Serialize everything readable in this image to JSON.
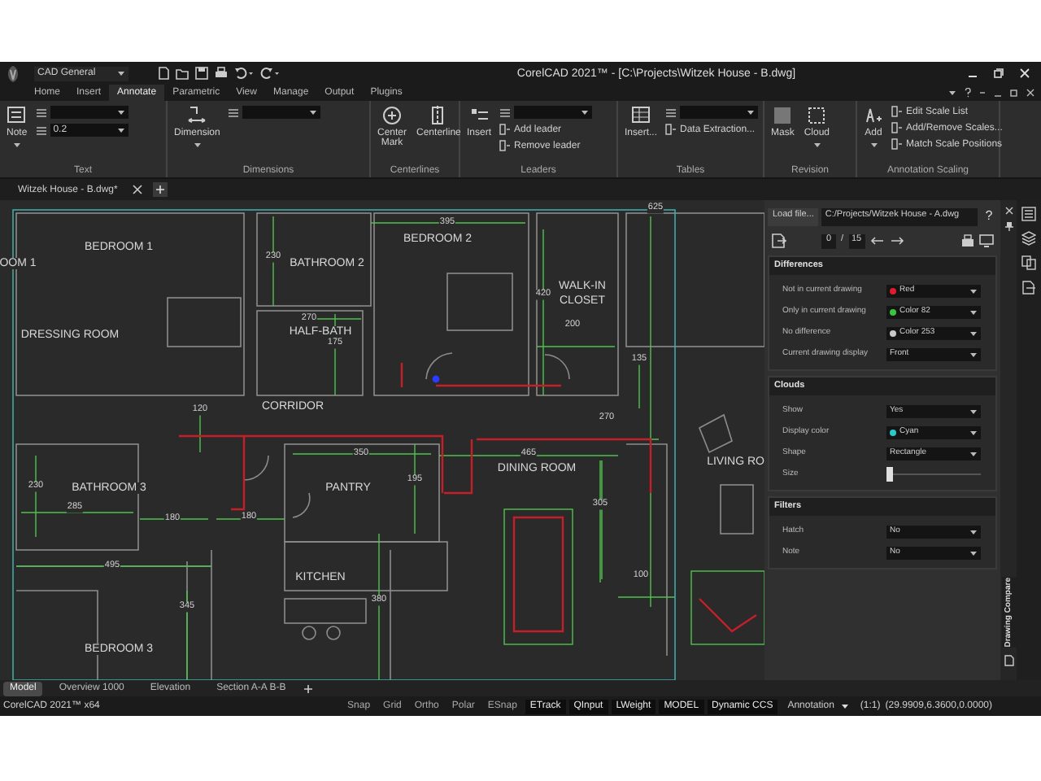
{
  "title_bar": {
    "workspace": "CAD General",
    "title": "CorelCAD 2021™ - [C:\\Projects\\Witzek House - B.dwg]"
  },
  "ribbon_tabs": [
    {
      "label": "Home",
      "selected": false
    },
    {
      "label": "Insert",
      "selected": false
    },
    {
      "label": "Annotate",
      "selected": true
    },
    {
      "label": "Parametric",
      "selected": false
    },
    {
      "label": "View",
      "selected": false
    },
    {
      "label": "Manage",
      "selected": false
    },
    {
      "label": "Output",
      "selected": false
    },
    {
      "label": "Plugins",
      "selected": false
    }
  ],
  "ribbon_groups": [
    {
      "label": "Text",
      "items": [
        {
          "kind": "large",
          "label": "Note",
          "menu": true
        },
        {
          "kind": "stack",
          "items": [
            {
              "kind": "field"
            },
            {
              "kind": "field",
              "value": "0.2"
            }
          ]
        }
      ]
    },
    {
      "label": "Dimensions",
      "items": [
        {
          "kind": "large",
          "label": "Dimension",
          "menu": true
        },
        {
          "kind": "stack",
          "items": [
            {
              "kind": "field"
            }
          ]
        }
      ]
    },
    {
      "label": "Centerlines",
      "items": [
        {
          "kind": "large",
          "label": "Center Mark",
          "menu": false
        },
        {
          "kind": "large",
          "label": "Centerline",
          "menu": false
        }
      ]
    },
    {
      "label": "Leaders",
      "items": [
        {
          "kind": "large",
          "label": "Insert",
          "menu": false
        },
        {
          "kind": "stack",
          "items": [
            {
              "kind": "field"
            },
            {
              "kind": "small",
              "label": "Add leader"
            },
            {
              "kind": "small",
              "label": "Remove leader"
            }
          ]
        }
      ]
    },
    {
      "label": "Tables",
      "items": [
        {
          "kind": "large",
          "label": "Insert...",
          "menu": false
        },
        {
          "kind": "stack",
          "items": [
            {
              "kind": "field"
            },
            {
              "kind": "small",
              "label": "Data Extraction..."
            }
          ]
        }
      ]
    },
    {
      "label": "Revision",
      "items": [
        {
          "kind": "large",
          "label": "Mask",
          "menu": false
        },
        {
          "kind": "large",
          "label": "Cloud",
          "menu": true
        }
      ]
    },
    {
      "label": "Annotation Scaling",
      "items": [
        {
          "kind": "large",
          "label": "Add",
          "menu": true
        },
        {
          "kind": "stack",
          "items": [
            {
              "kind": "small",
              "label": "Edit Scale List"
            },
            {
              "kind": "small",
              "label": "Add/Remove Scales..."
            },
            {
              "kind": "small",
              "label": "Match Scale Positions"
            }
          ]
        }
      ]
    }
  ],
  "document_tab": {
    "label": "Witzek House - B.dwg*"
  },
  "drawing": {
    "labels": [
      {
        "text": "OOM 1",
        "kind": "room"
      },
      {
        "text": "BEDROOM 1",
        "kind": "room"
      },
      {
        "text": "DRESSING ROOM",
        "kind": "room"
      },
      {
        "text": "230",
        "kind": "dimension"
      },
      {
        "text": "BATHROOM 2",
        "kind": "room"
      },
      {
        "text": "395",
        "kind": "dimension"
      },
      {
        "text": "BEDROOM 2",
        "kind": "room"
      },
      {
        "text": "625",
        "kind": "dimension"
      },
      {
        "text": "420",
        "kind": "dimension"
      },
      {
        "text": "WALK-IN",
        "kind": "room"
      },
      {
        "text": "CLOSET",
        "kind": "room"
      },
      {
        "text": "270",
        "kind": "dimension"
      },
      {
        "text": "HALF-BATH",
        "kind": "room"
      },
      {
        "text": "175",
        "kind": "dimension"
      },
      {
        "text": "200",
        "kind": "dimension"
      },
      {
        "text": "135",
        "kind": "dimension"
      },
      {
        "text": "120",
        "kind": "dimension"
      },
      {
        "text": "CORRIDOR",
        "kind": "room"
      },
      {
        "text": "270",
        "kind": "dimension"
      },
      {
        "text": "350",
        "kind": "dimension"
      },
      {
        "text": "465",
        "kind": "dimension"
      },
      {
        "text": "DINING ROOM",
        "kind": "room"
      },
      {
        "text": "LIVING RO",
        "kind": "room"
      },
      {
        "text": "195",
        "kind": "dimension"
      },
      {
        "text": "230",
        "kind": "dimension"
      },
      {
        "text": "BATHROOM 3",
        "kind": "room"
      },
      {
        "text": "PANTRY",
        "kind": "room"
      },
      {
        "text": "285",
        "kind": "dimension"
      },
      {
        "text": "180",
        "kind": "dimension"
      },
      {
        "text": "180",
        "kind": "dimension"
      },
      {
        "text": "305",
        "kind": "dimension"
      },
      {
        "text": "495",
        "kind": "dimension"
      },
      {
        "text": "KITCHEN",
        "kind": "room"
      },
      {
        "text": "345",
        "kind": "dimension"
      },
      {
        "text": "380",
        "kind": "dimension"
      },
      {
        "text": "100",
        "kind": "dimension"
      },
      {
        "text": "BEDROOM 3",
        "kind": "room"
      }
    ]
  },
  "compare_panel": {
    "load_button": "Load file...",
    "file_path": "C:/Projects/Witzek House - A.dwg",
    "help": "?",
    "current": "0",
    "separator": "/",
    "total": "15",
    "sections": [
      {
        "title": "Differences",
        "rows": [
          {
            "kind": "dropdown",
            "label": "Not in current drawing",
            "value": "Red",
            "color": "#e01b2c"
          },
          {
            "kind": "dropdown",
            "label": "Only in current drawing",
            "value": "Color 82",
            "color": "#3cc43c"
          },
          {
            "kind": "dropdown",
            "label": "No difference",
            "value": "Color 253",
            "color": "#c8c8c8"
          },
          {
            "kind": "dropdown",
            "label": "Current drawing display",
            "value": "Front"
          }
        ]
      },
      {
        "title": "Clouds",
        "rows": [
          {
            "kind": "dropdown",
            "label": "Show",
            "value": "Yes"
          },
          {
            "kind": "dropdown",
            "label": "Display color",
            "value": "Cyan",
            "color": "#2ec8c8"
          },
          {
            "kind": "dropdown",
            "label": "Shape",
            "value": "Rectangle"
          },
          {
            "kind": "slider",
            "label": "Size",
            "level": 0
          }
        ]
      },
      {
        "title": "Filters",
        "rows": [
          {
            "kind": "dropdown",
            "label": "Hatch",
            "value": "No"
          },
          {
            "kind": "dropdown",
            "label": "Note",
            "value": "No"
          }
        ]
      }
    ],
    "side_tab": "Drawing Compare"
  },
  "layout_tabs": [
    {
      "label": "Model",
      "selected": true
    },
    {
      "label": "Overview 1000",
      "selected": false
    },
    {
      "label": "Elevation",
      "selected": false
    },
    {
      "label": "Section A-A B-B",
      "selected": false
    }
  ],
  "status_bar": {
    "app": "CorelCAD 2021™ x64",
    "toggles": [
      {
        "label": "Snap",
        "on": false
      },
      {
        "label": "Grid",
        "on": false
      },
      {
        "label": "Ortho",
        "on": false
      },
      {
        "label": "Polar",
        "on": false
      },
      {
        "label": "ESnap",
        "on": false
      },
      {
        "label": "ETrack",
        "on": true
      },
      {
        "label": "QInput",
        "on": true
      },
      {
        "label": "LWeight",
        "on": true
      },
      {
        "label": "MODEL",
        "on": true
      },
      {
        "label": "Dynamic CCS",
        "on": true
      }
    ],
    "annotation": "Annotation",
    "scale": "(1:1)",
    "coordinates": "(29.9909,6.3600,0.0000)"
  }
}
